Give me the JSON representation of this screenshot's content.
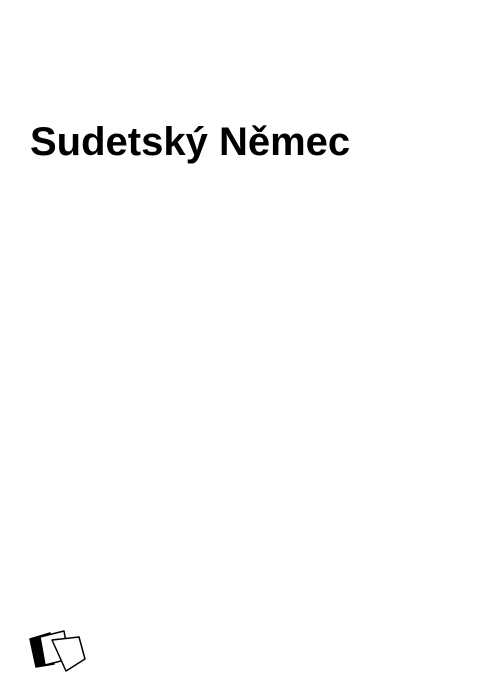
{
  "document": {
    "title": "Sudetský Němec"
  },
  "logo": {
    "icon": "stacked-cards-icon",
    "colors": {
      "front_fill": "#ffffff",
      "back_fill": "#000000",
      "stroke": "#000000"
    }
  }
}
